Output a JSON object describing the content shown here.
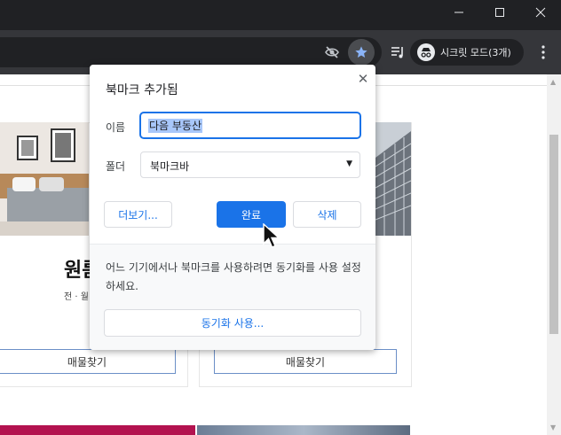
{
  "titlebar": {
    "minimize_icon": "minimize-icon",
    "maximize_icon": "maximize-icon",
    "close_icon": "close-icon"
  },
  "toolbar": {
    "incognito_label": "시크릿 모드(3개)",
    "icons": [
      "eye-off-icon",
      "star-icon",
      "reading-list-icon",
      "incognito-icon",
      "kebab-menu-icon"
    ],
    "star_color": "#8ab4f8"
  },
  "page": {
    "card_left_title": "원룸",
    "card_left_subtitle": "전 · 월",
    "find_listing_left": "매물찾기",
    "find_listing_right": "매물찾기"
  },
  "popup": {
    "title": "북마크 추가됨",
    "name_label": "이름",
    "name_value": "다음 부동산",
    "folder_label": "폴더",
    "folder_value": "북마크바",
    "more_button": "더보기...",
    "done_button": "완료",
    "delete_button": "삭제",
    "sync_message": "어느 기기에서나 북마크를 사용하려면 동기화를 사용 설정하세요.",
    "sync_button": "동기화 사용...",
    "accent": "#1a73e8"
  }
}
